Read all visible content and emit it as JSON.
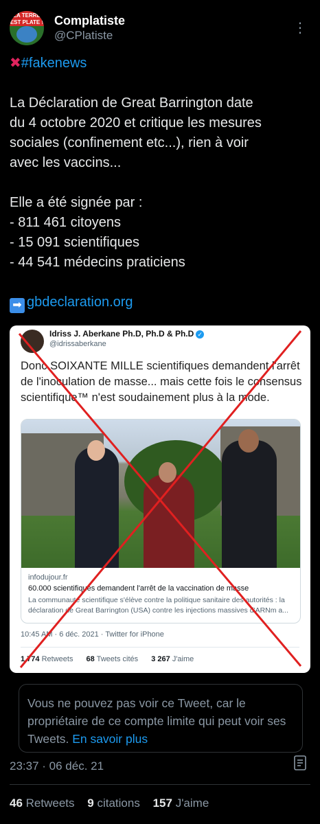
{
  "author": {
    "name": "Complatiste",
    "handle": "@CPlatiste",
    "avatar_text": "LA TERRE EST PLATE !"
  },
  "more_icon": "more-dots-icon",
  "tweet": {
    "hashtag": "#fakenews",
    "lines": [
      "La Déclaration de Great Barrington date",
      "du 4 octobre 2020 et critique les mesures",
      "sociales (confinement etc...), rien à voir",
      "avec les vaccins...",
      "Elle a été signée par :",
      "- 811 461 citoyens",
      "- 15 091 scientifiques",
      "- 44 541 médecins praticiens"
    ],
    "link": "gbdeclaration.org"
  },
  "embedded": {
    "name": "Idriss J. Aberkane Ph.D, Ph.D & Ph.D",
    "handle": "@idrissaberkane",
    "text": "Donc SOIXANTE MILLE scientifiques demandent l'arrêt de l'inoculation de masse... mais cette fois le consensus scientifique™ n'est soudainement plus à la mode.",
    "card": {
      "domain": "infodujour.fr",
      "title": "60.000 scientifiques demandent l'arrêt de la vaccination de masse",
      "description": "La communauté scientifique s'élève contre la politique sanitaire des autorités : la déclaration de Great Barrington (USA) contre les injections massives d'ARNm a..."
    },
    "meta": "10:45 AM · 6 déc. 2021 · Twitter for iPhone",
    "stats": {
      "retweets_count": "1 774",
      "retweets_label": "Retweets",
      "quotes_count": "68",
      "quotes_label": "Tweets cités",
      "likes_count": "3 267",
      "likes_label": "J'aime"
    },
    "cross_color": "#e02020"
  },
  "notice": {
    "text": "Vous ne pouvez pas voir ce Tweet, car le propriétaire de ce compte limite qui peut voir ses Tweets.",
    "link": "En savoir plus"
  },
  "timestamp": "23:37 · 06 déc. 21",
  "stats": {
    "retweets_count": "46",
    "retweets_label": "Retweets",
    "quotes_count": "9",
    "quotes_label": "citations",
    "likes_count": "157",
    "likes_label": "J'aime"
  },
  "colors": {
    "background": "#000000",
    "accent": "#1d9bf0",
    "muted": "#8b98a5"
  }
}
